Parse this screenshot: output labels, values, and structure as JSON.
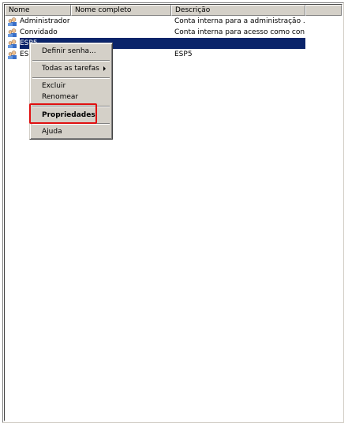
{
  "columns": [
    "Nome",
    "Nome completo",
    "Descrição"
  ],
  "users": [
    {
      "name": "Administrador",
      "description": "Conta interna para a administração ..."
    },
    {
      "name": "Convidado",
      "description": "Conta interna para acesso como con..."
    },
    {
      "name": "ESP5",
      "description": ""
    },
    {
      "name": "ESP5",
      "description": "ESP5"
    }
  ],
  "context_menu": {
    "set_password": "Definir senha...",
    "all_tasks": "Todas as tarefas",
    "delete": "Excluir",
    "rename": "Renomear",
    "properties": "Propriedades",
    "help": "Ajuda"
  },
  "colors": {
    "selection": "#0a246a",
    "highlight": "#e01010"
  }
}
